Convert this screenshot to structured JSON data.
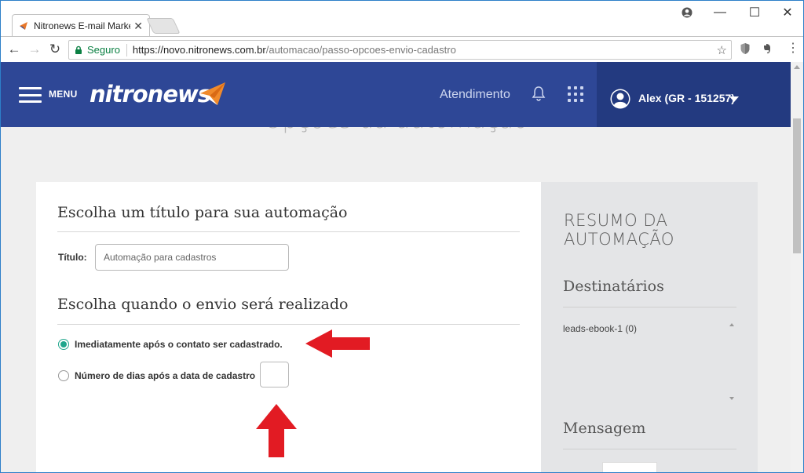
{
  "browser": {
    "tab_title": "Nitronews E-mail Marketi",
    "secure_label": "Seguro",
    "url_host": "https://novo.nitronews.com.br",
    "url_path": "/automacao/passo-opcoes-envio-cadastro"
  },
  "header": {
    "menu_label": "MENU",
    "logo_text": "nitronews",
    "support_label": "Atendimento",
    "user_label": "Alex (GR - 151257)"
  },
  "page": {
    "title": "Opções da automação"
  },
  "form": {
    "title_section_heading": "Escolha um título para sua automação",
    "title_field_label": "Título:",
    "title_field_value": "Automação para cadastros",
    "when_section_heading": "Escolha quando o envio será realizado",
    "option_immediate_label": "Imediatamente após o contato ser cadastrado.",
    "option_days_label": "Número de dias após a data de cadastro",
    "days_value": "",
    "selected_option": "immediate"
  },
  "summary": {
    "title_line1": "RESUMO DA",
    "title_line2": "AUTOMAÇÃO",
    "recipients_heading": "Destinatários",
    "recipients": [
      "leads-ebook-1 (0)"
    ],
    "message_heading": "Mensagem"
  },
  "colors": {
    "header_bg": "#2e4796",
    "accent_radio": "#1fa68c",
    "annotation_arrow": "#e21b23",
    "secure_green": "#0b8043"
  }
}
